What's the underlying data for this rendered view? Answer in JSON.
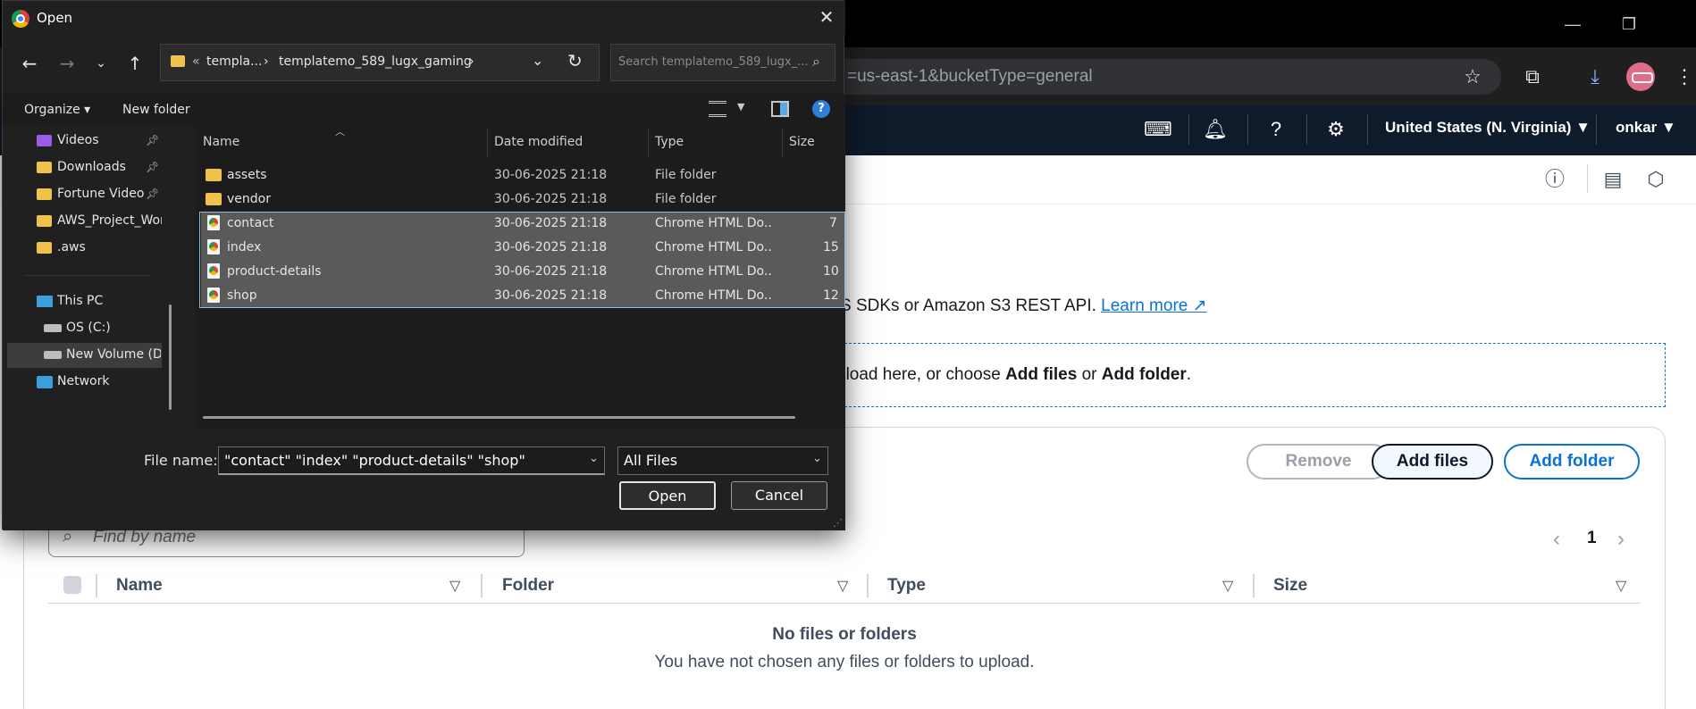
{
  "browser": {
    "url_fragment": "=us-east-1&bucketType=general",
    "icons": [
      "minimize-icon",
      "restore-icon",
      "star-icon",
      "extensions-icon",
      "download-icon",
      "profile-avatar",
      "kebab-menu-icon"
    ]
  },
  "aws_header": {
    "region": "United States (N. Virginia) ▼",
    "user": "onkar ▼",
    "icons": [
      "cloudshell-icon",
      "bell-icon",
      "help-icon",
      "gear-icon"
    ]
  },
  "page": {
    "intro_prefix": "S SDKs or Amazon S3 REST API.",
    "learn_more": "Learn more",
    "drop_prefix": "pload here, or choose ",
    "drop_add_files": "Add files",
    "drop_or": " or ",
    "drop_add_folder": "Add folder",
    "drop_end": ".",
    "buttons": {
      "remove": "Remove",
      "add_files": "Add files",
      "add_folder": "Add folder"
    },
    "search_placeholder": "Find by name",
    "pagination": {
      "current": "1"
    },
    "table": {
      "columns": [
        "Name",
        "Folder",
        "Type",
        "Size"
      ],
      "empty_title": "No files or folders",
      "empty_subtitle": "You have not chosen any files or folders to upload."
    }
  },
  "dialog": {
    "title": "Open",
    "breadcrumb": {
      "overflow": "«",
      "parts": [
        "templa...",
        "templatemo_589_lugx_gaming"
      ],
      "separator": "›"
    },
    "search_placeholder": "Search templatemo_589_lugx_...",
    "commands": {
      "organize": "Organize ▾",
      "new_folder": "New folder"
    },
    "nav_items": [
      {
        "label": "Videos",
        "pinned": true
      },
      {
        "label": "Downloads",
        "pinned": true
      },
      {
        "label": "Fortune Videos",
        "pinned": true
      },
      {
        "label": "AWS_Project_Wor",
        "pinned": false
      },
      {
        "label": ".aws",
        "pinned": false
      },
      {
        "label": "This PC",
        "pinned": false
      },
      {
        "label": "OS (C:)",
        "pinned": false
      },
      {
        "label": "New Volume (D:",
        "pinned": false
      },
      {
        "label": "Network",
        "pinned": false
      }
    ],
    "columns": {
      "name": "Name",
      "date": "Date modified",
      "type": "Type",
      "size": "Size"
    },
    "files": [
      {
        "name": "assets",
        "date": "30-06-2025 21:18",
        "type": "File folder",
        "size": "",
        "kind": "folder",
        "selected": false
      },
      {
        "name": "vendor",
        "date": "30-06-2025 21:18",
        "type": "File folder",
        "size": "",
        "kind": "folder",
        "selected": false
      },
      {
        "name": "contact",
        "date": "30-06-2025 21:18",
        "type": "Chrome HTML Do...",
        "size": "7",
        "kind": "html",
        "selected": true
      },
      {
        "name": "index",
        "date": "30-06-2025 21:18",
        "type": "Chrome HTML Do...",
        "size": "15",
        "kind": "html",
        "selected": true
      },
      {
        "name": "product-details",
        "date": "30-06-2025 21:18",
        "type": "Chrome HTML Do...",
        "size": "10",
        "kind": "html",
        "selected": true
      },
      {
        "name": "shop",
        "date": "30-06-2025 21:18",
        "type": "Chrome HTML Do...",
        "size": "12",
        "kind": "html",
        "selected": true
      }
    ],
    "file_name_label": "File name:",
    "file_name_value": "\"contact\" \"index\" \"product-details\" \"shop\"",
    "file_type": "All Files",
    "open_label": "Open",
    "cancel_label": "Cancel"
  }
}
